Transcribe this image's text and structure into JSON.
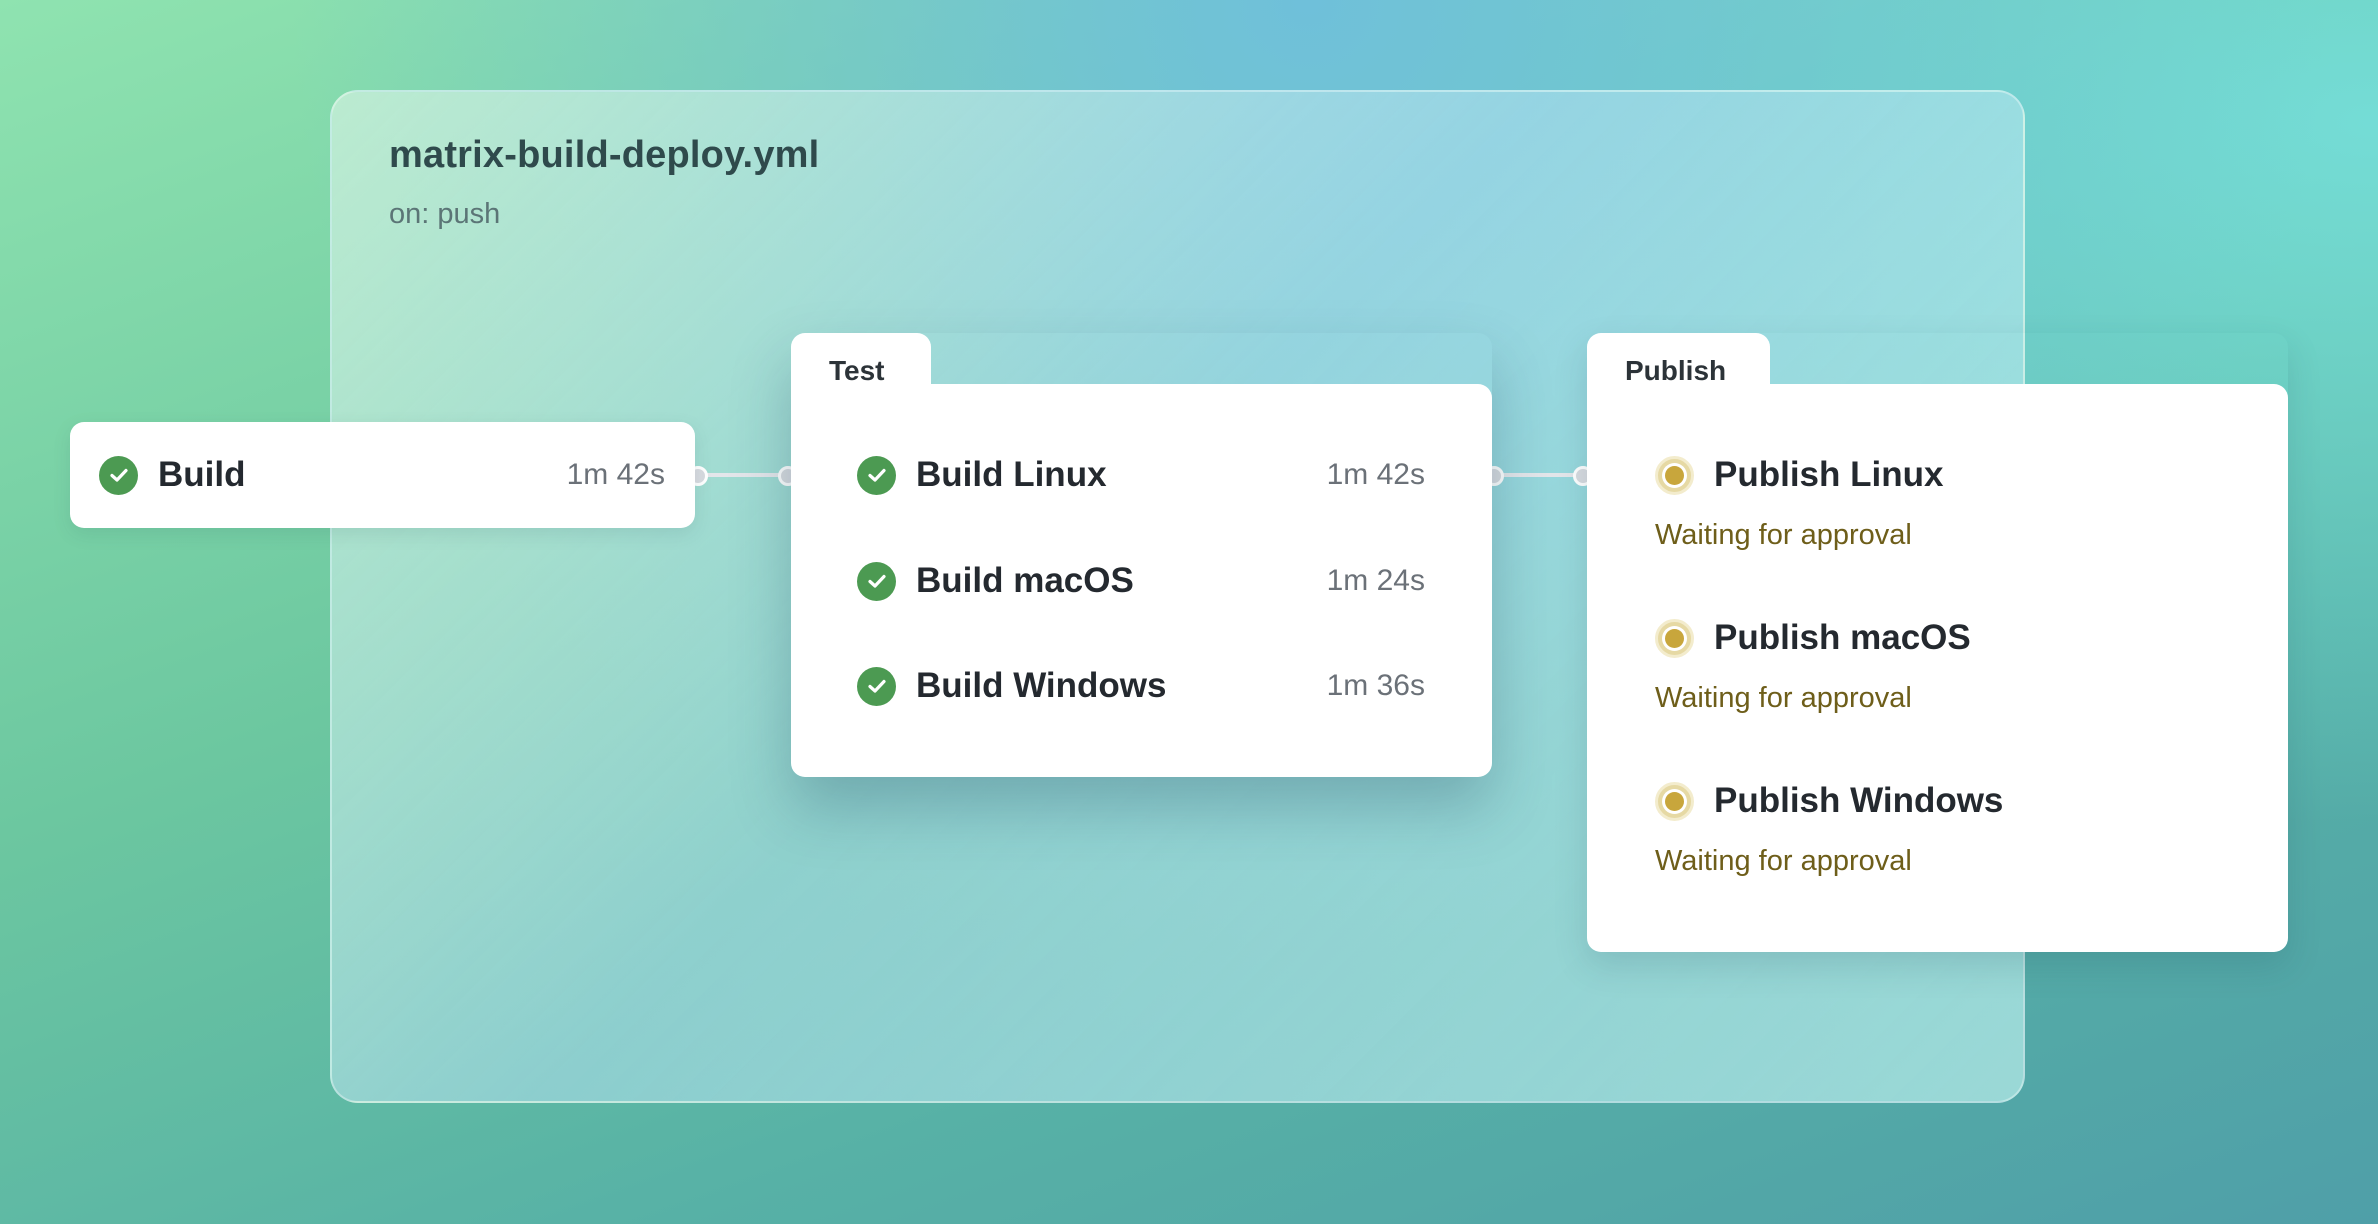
{
  "workflow": {
    "title": "matrix-build-deploy.yml",
    "trigger": "on: push"
  },
  "build": {
    "label": "Build",
    "duration": "1m 42s",
    "status": "success"
  },
  "test": {
    "group_label": "Test",
    "jobs": [
      {
        "label": "Build Linux",
        "duration": "1m 42s",
        "status": "success"
      },
      {
        "label": "Build macOS",
        "duration": "1m 24s",
        "status": "success"
      },
      {
        "label": "Build Windows",
        "duration": "1m 36s",
        "status": "success"
      }
    ]
  },
  "publish": {
    "group_label": "Publish",
    "jobs": [
      {
        "label": "Publish Linux",
        "status_text": "Waiting for approval",
        "status": "waiting"
      },
      {
        "label": "Publish macOS",
        "status_text": "Waiting for approval",
        "status": "waiting"
      },
      {
        "label": "Publish Windows",
        "status_text": "Waiting for approval",
        "status": "waiting"
      }
    ]
  },
  "colors": {
    "success": "#4c9a52",
    "waiting": "#c8a63c",
    "waiting_text": "#6e5e1a"
  },
  "icons": {
    "success": "check-circle-icon",
    "waiting": "pending-circle-icon"
  }
}
